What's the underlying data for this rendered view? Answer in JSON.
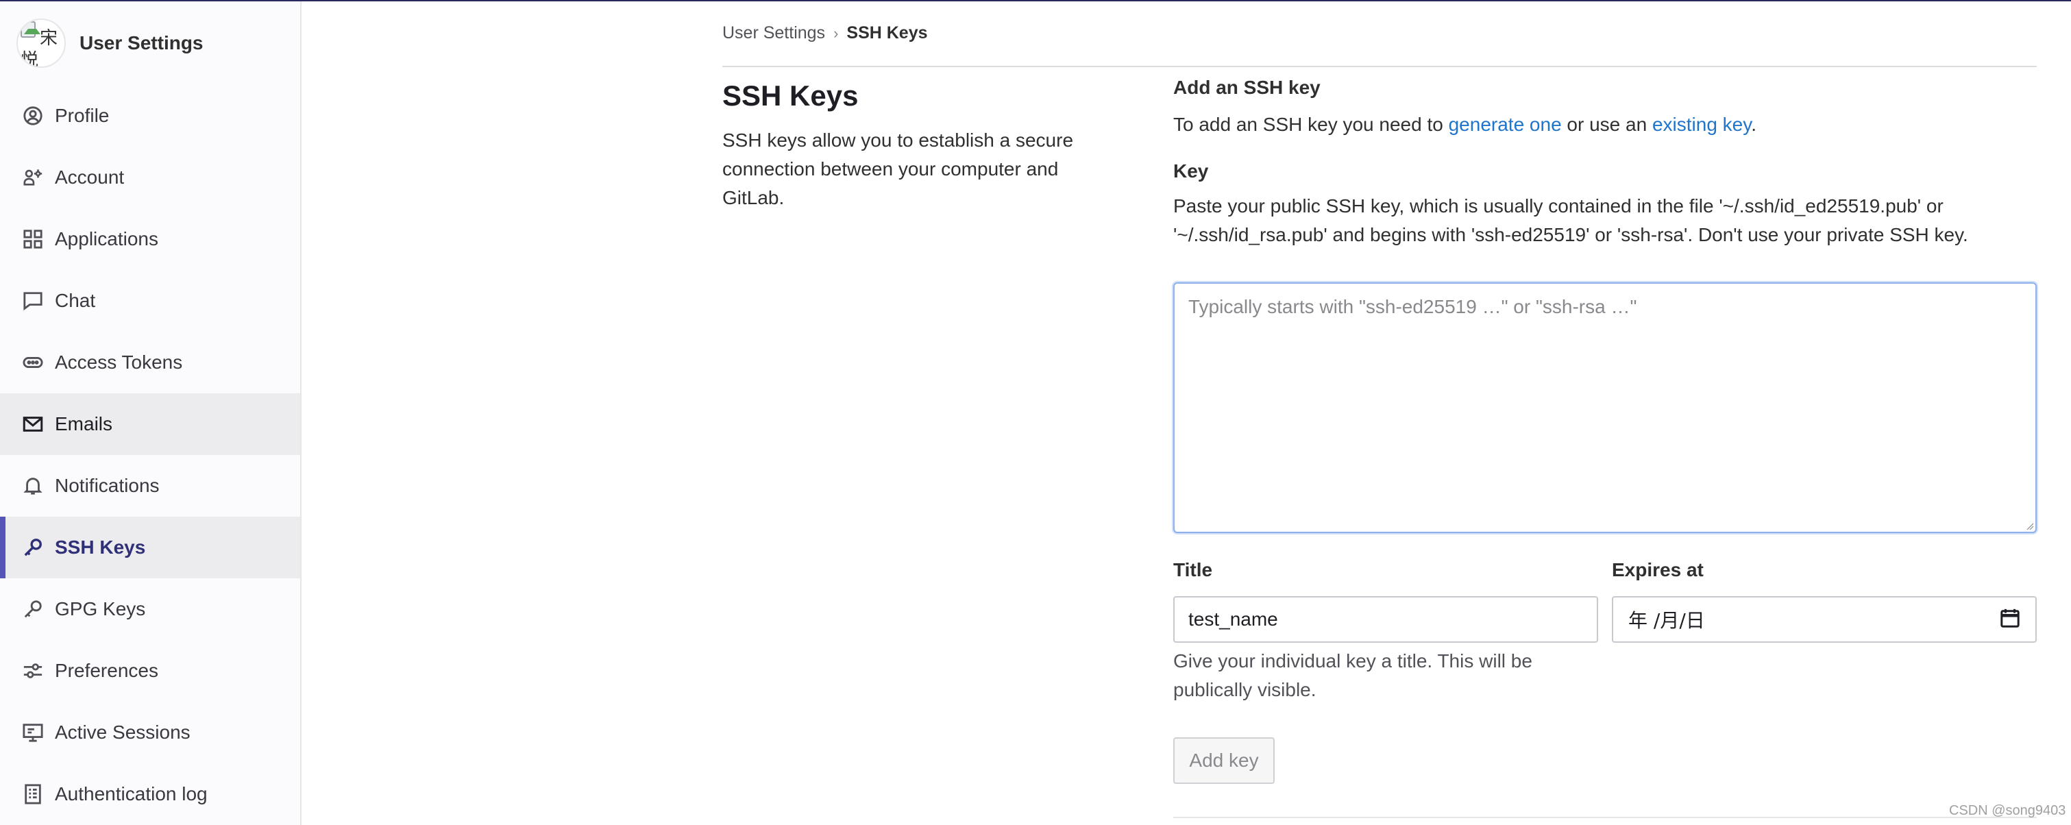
{
  "sidebar": {
    "avatar_chars": [
      "宋",
      "悦"
    ],
    "title": "User Settings",
    "items": [
      {
        "label": "Profile",
        "icon": "profile-icon"
      },
      {
        "label": "Account",
        "icon": "account-icon"
      },
      {
        "label": "Applications",
        "icon": "applications-icon"
      },
      {
        "label": "Chat",
        "icon": "chat-icon"
      },
      {
        "label": "Access Tokens",
        "icon": "token-icon"
      },
      {
        "label": "Emails",
        "icon": "mail-icon"
      },
      {
        "label": "Notifications",
        "icon": "bell-icon"
      },
      {
        "label": "SSH Keys",
        "icon": "key-icon"
      },
      {
        "label": "GPG Keys",
        "icon": "key-icon"
      },
      {
        "label": "Preferences",
        "icon": "preferences-icon"
      },
      {
        "label": "Active Sessions",
        "icon": "monitor-icon"
      },
      {
        "label": "Authentication log",
        "icon": "log-icon"
      }
    ],
    "active_item": "SSH Keys",
    "hovered_item": "Emails"
  },
  "breadcrumb": {
    "parent": "User Settings",
    "separator": "›",
    "current": "SSH Keys"
  },
  "page": {
    "title": "SSH Keys",
    "description": "SSH keys allow you to establish a secure connection between your computer and GitLab."
  },
  "form": {
    "heading": "Add an SSH key",
    "intro_prefix": "To add an SSH key you need to ",
    "intro_link1": "generate one",
    "intro_middle": " or use an ",
    "intro_link2": "existing key",
    "intro_suffix": ".",
    "key_label": "Key",
    "key_description": "Paste your public SSH key, which is usually contained in the file '~/.ssh/id_ed25519.pub' or '~/.ssh/id_rsa.pub' and begins with 'ssh-ed25519' or 'ssh-rsa'. Don't use your private SSH key.",
    "key_placeholder": "Typically starts with \"ssh-ed25519 …\" or \"ssh-rsa …\"",
    "key_value": "",
    "title_label": "Title",
    "title_value": "test_name",
    "title_help": "Give your individual key a title. This will be publically visible.",
    "expires_label": "Expires at",
    "expires_value": "年 /月/日",
    "submit_label": "Add key"
  },
  "watermark": "CSDN @song9403",
  "colors": {
    "accent": "#5555b8",
    "link": "#1f75cb",
    "focus_border": "#8fb0e8"
  }
}
